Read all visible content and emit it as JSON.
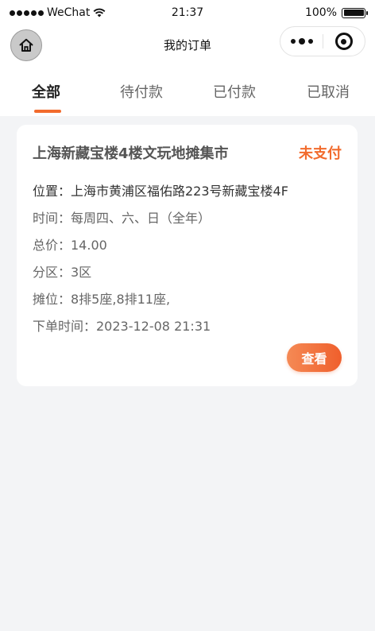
{
  "status_bar": {
    "carrier": "WeChat",
    "time": "21:37",
    "battery": "100%"
  },
  "nav": {
    "title": "我的订单"
  },
  "tabs": [
    {
      "label": "全部",
      "active": true
    },
    {
      "label": "待付款",
      "active": false
    },
    {
      "label": "已付款",
      "active": false
    },
    {
      "label": "已取消",
      "active": false
    }
  ],
  "orders": [
    {
      "title": "上海新藏宝楼4楼文玩地摊集市",
      "status": "未支付",
      "location": "位置：上海市黄浦区福佑路223号新藏宝楼4F",
      "time": "时间：每周四、六、日（全年）",
      "total": "总价：14.00",
      "zone": "分区：3区",
      "stall": "摊位：8排5座,8排11座,",
      "order_time": "下单时间：2023-12-08 21:31",
      "action_label": "查看"
    }
  ],
  "colors": {
    "accent": "#f26b2d",
    "background": "#f3f4f6"
  }
}
